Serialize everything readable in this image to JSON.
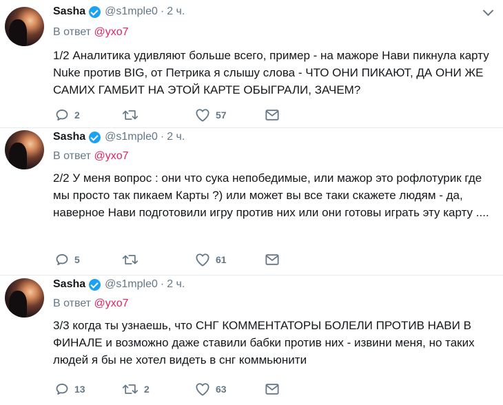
{
  "tweets": [
    {
      "name": "Sasha",
      "handle": "@s1mple0",
      "time": "2 ч.",
      "reply_prefix": "В ответ",
      "reply_to": "@yxo7",
      "text": "1/2 Аналитика удивляют больше всего, пример - на мажоре Нави пикнула карту Nuke против BIG, от Петрика я слышу слова - ЧТО ОНИ ПИКАЮТ, ДА ОНИ ЖЕ САМИХ ГАМБИТ НА ЭТОЙ КАРТЕ ОБЫГРАЛИ, ЗАЧЕМ?",
      "replies": "2",
      "retweets": "",
      "likes": "57"
    },
    {
      "name": "Sasha",
      "handle": "@s1mple0",
      "time": "2 ч.",
      "reply_prefix": "В ответ",
      "reply_to": "@yxo7",
      "text": "2/2 У меня вопрос : они что сука непобедимые, или мажор это рофлотурик где мы просто так пикаем Карты ?) или может вы все таки скажете людям - да, наверное Нави подготовили игру против них или они готовы играть эту карту ....",
      "replies": "5",
      "retweets": "",
      "likes": "61"
    },
    {
      "name": "Sasha",
      "handle": "@s1mple0",
      "time": "2 ч.",
      "reply_prefix": "В ответ",
      "reply_to": "@yxo7",
      "text": "3/3 когда ты узнаешь, что СНГ КОММЕНТАТОРЫ БОЛЕЛИ ПРОТИВ НАВИ В ФИНАЛЕ и возможно даже ставили бабки против них - извини меня, но таких людей я бы не хотел видеть в снг коммьюнити",
      "replies": "13",
      "retweets": "2",
      "likes": "63"
    }
  ],
  "icons": {
    "reply": "reply-icon",
    "retweet": "retweet-icon",
    "like": "like-icon",
    "dm": "direct-message-icon",
    "verified": "verified-badge-icon",
    "menu": "chevron-down-icon"
  },
  "colors": {
    "text": "#14171a",
    "secondary": "#657786",
    "mention": "#e0245e",
    "verified": "#1da1f2",
    "divider": "#e6ecf0"
  }
}
